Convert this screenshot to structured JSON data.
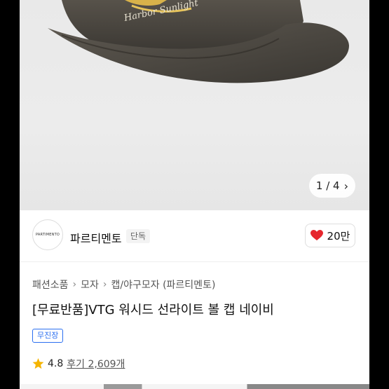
{
  "gallery": {
    "hat_embroidery": "Harbor Sunlight",
    "counter": "1 / 4"
  },
  "brand": {
    "logo_text": "PARTIMENTO",
    "name": "파르티멘토",
    "tag": "단독"
  },
  "like": {
    "count": "20만",
    "color": "#e6262d"
  },
  "breadcrumb": [
    "패션소품",
    "모자",
    "캡/야구모자 (파르티멘토)"
  ],
  "product": {
    "title": "[무료반품]VTG 워시드 선라이트 볼 캡 네이비",
    "badge": "무진장",
    "rating": "4.8",
    "reviews": "후기 2,609개"
  },
  "colors": {
    "accent_blue": "#2b6ff0",
    "star": "#f5b400"
  }
}
